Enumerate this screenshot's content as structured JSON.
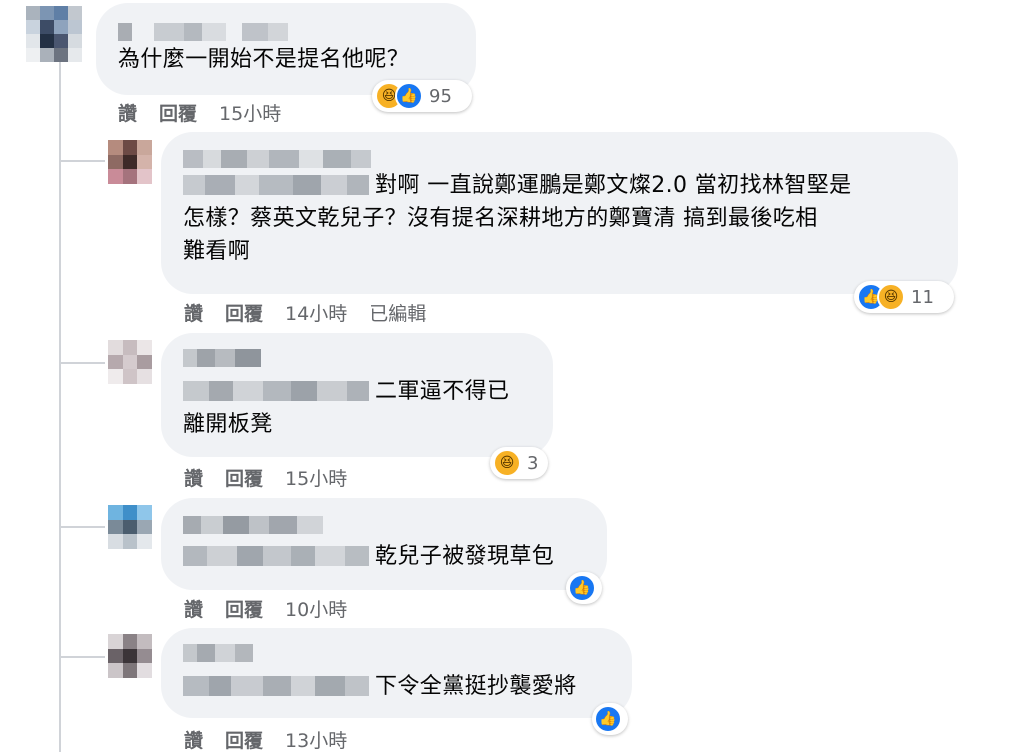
{
  "comments": [
    {
      "text": "為什麼一開始不是提名他呢？",
      "actions": {
        "like": "讚",
        "reply": "回覆",
        "time": "15小時"
      },
      "reaction_count": "95",
      "reactions": [
        "haha-icon",
        "like-icon"
      ]
    },
    {
      "text_line1": "對啊 一直說鄭運鵬是鄭文燦2.0 當初找林智堅是",
      "text_line2": "怎樣？蔡英文乾兒子？沒有提名深耕地方的鄭寶清 搞到最後吃相",
      "text_line3": "難看啊",
      "actions": {
        "like": "讚",
        "reply": "回覆",
        "time": "14小時",
        "edited": "已編輯"
      },
      "reaction_count": "11",
      "reactions": [
        "like-icon",
        "haha-icon"
      ]
    },
    {
      "text_line1": "二軍逼不得已",
      "text_line2": "離開板凳",
      "actions": {
        "like": "讚",
        "reply": "回覆",
        "time": "15小時"
      },
      "reaction_count": "3",
      "reactions": [
        "haha-icon"
      ]
    },
    {
      "text": "乾兒子被發現草包",
      "actions": {
        "like": "讚",
        "reply": "回覆",
        "time": "10小時"
      },
      "reactions": [
        "like-icon"
      ]
    },
    {
      "text": "下令全黨挺抄襲愛將",
      "actions": {
        "like": "讚",
        "reply": "回覆",
        "time": "13小時"
      },
      "reactions": [
        "like-icon"
      ]
    }
  ],
  "colors": {
    "bubble": "#f0f2f5",
    "meta": "#65676b",
    "like": "#1877f2",
    "haha": "#f7b125"
  }
}
